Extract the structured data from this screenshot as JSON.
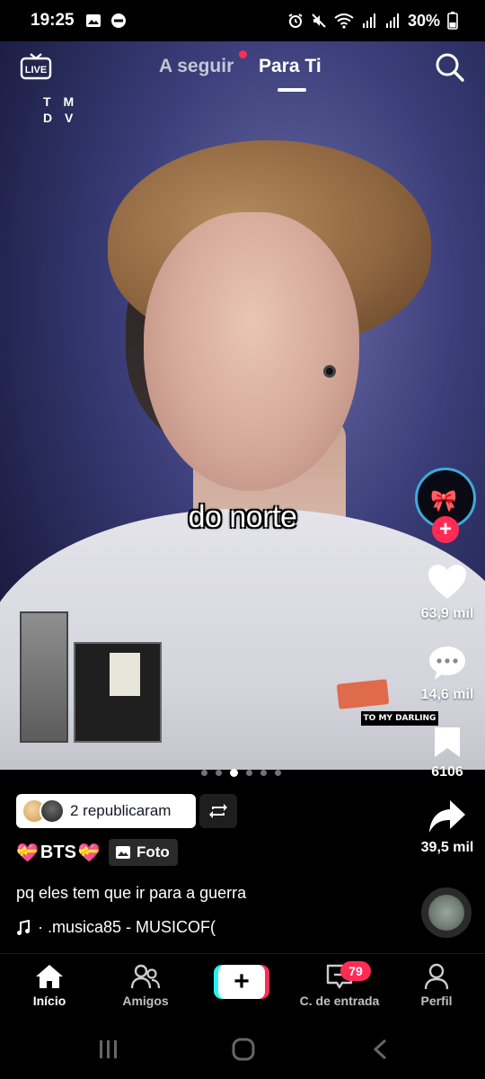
{
  "status_bar": {
    "time": "19:25",
    "battery": "30%",
    "left_icons": [
      "gallery-icon",
      "do-not-disturb-icon"
    ],
    "right_icons": [
      "alarm-icon",
      "mute-icon",
      "wifi-icon",
      "signal-icon",
      "signal-icon",
      "battery-icon"
    ]
  },
  "top_nav": {
    "live_label": "LIVE",
    "tabs": [
      {
        "label": "A seguir",
        "active": false,
        "has_dot": true
      },
      {
        "label": "Para Ti",
        "active": true
      }
    ]
  },
  "post": {
    "watermark_lines": [
      "T M",
      "D V"
    ],
    "caption_overlay": "do norte",
    "carousel": {
      "count": 6,
      "active_index": 2
    },
    "music_label": "TO MY DARLING",
    "actions": {
      "likes": "63,9 mil",
      "comments": "14,6 mil",
      "saves": "6106",
      "shares": "39,5 mil"
    },
    "repost": {
      "text": "2 republicaram"
    },
    "author": {
      "name": "BTS"
    },
    "badge": {
      "label": "Foto"
    },
    "description": "pq eles tem que ir para a guerra",
    "music": "· .musica85 - MUSICOF("
  },
  "tab_bar": {
    "items": [
      {
        "label": "Início",
        "icon": "home-icon",
        "active": true
      },
      {
        "label": "Amigos",
        "icon": "friends-icon"
      },
      {
        "label": "",
        "icon": "create-icon"
      },
      {
        "label": "C. de entrada",
        "icon": "inbox-icon",
        "badge": "79"
      },
      {
        "label": "Perfil",
        "icon": "profile-icon"
      }
    ]
  },
  "colors": {
    "accent": "#fe2c55",
    "cyan": "#25f4ee",
    "background": "#000000"
  }
}
